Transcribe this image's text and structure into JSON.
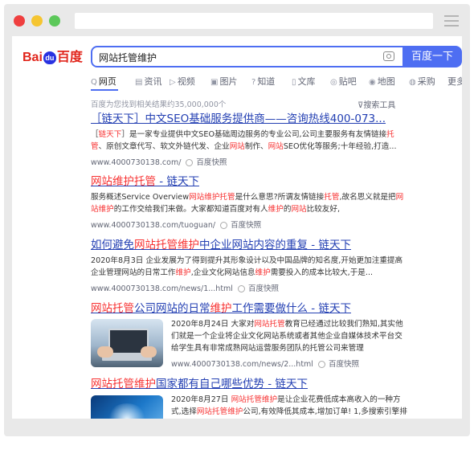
{
  "browser": {
    "url": ""
  },
  "logo": {
    "part1": "Bai",
    "paw": "du",
    "part2": "百度"
  },
  "search": {
    "query": "网站托管维护",
    "button": "百度一下"
  },
  "tabs": [
    {
      "icon": "Q",
      "label": "网页"
    },
    {
      "icon": "▤",
      "label": "资讯"
    },
    {
      "icon": "▷",
      "label": "视频"
    },
    {
      "icon": "▣",
      "label": "图片"
    },
    {
      "icon": "?",
      "label": "知道"
    },
    {
      "icon": "▯",
      "label": "文库"
    },
    {
      "icon": "◎",
      "label": "贴吧"
    },
    {
      "icon": "◉",
      "label": "地图"
    },
    {
      "icon": "◍",
      "label": "采购"
    },
    {
      "icon": "",
      "label": "更多"
    }
  ],
  "result_count": "百度为您找到相关结果约35,000,000个",
  "search_tools": "搜索工具",
  "results": [
    {
      "title": [
        [
          "",
          "［链天下］中文SEO基础服务提供商——咨询热线400-073..."
        ]
      ],
      "desc": [
        [
          "",
          "［"
        ],
        [
          "hl",
          "链天下"
        ],
        [
          "",
          "］是一家专业提供中文SEO基础周边服务的专业公司,公司主要服务有友情链接"
        ],
        [
          "hl",
          "托管"
        ],
        [
          "",
          "、原创文章代写、软文外链代发、企业"
        ],
        [
          "hl",
          "网站"
        ],
        [
          "",
          "制作、"
        ],
        [
          "hl",
          "网站"
        ],
        [
          "",
          "SEO优化等服务;十年经验,打造..."
        ]
      ],
      "url": "www.4000730138.com/",
      "snapshot": "百度快照"
    },
    {
      "title": [
        [
          "hl",
          "网站维护托管"
        ],
        [
          "",
          " - 链天下"
        ]
      ],
      "desc": [
        [
          "",
          "服务概述Service Overview"
        ],
        [
          "hl",
          "网站维护托管"
        ],
        [
          "",
          "是什么意思?所谓友情链接"
        ],
        [
          "hl",
          "托管"
        ],
        [
          "",
          ",故名思义就是把"
        ],
        [
          "hl",
          "网站维护"
        ],
        [
          "",
          "的工作交给我们来做。大家都知道百度对有人"
        ],
        [
          "hl",
          "维护"
        ],
        [
          "",
          "的"
        ],
        [
          "hl",
          "网站"
        ],
        [
          "",
          "比较友好,"
        ]
      ],
      "url": "www.4000730138.com/tuoguan/",
      "snapshot": "百度快照"
    },
    {
      "title": [
        [
          "",
          "如何避免"
        ],
        [
          "hl",
          "网站托管维护"
        ],
        [
          "",
          "中企业网站内容的重复 - 链天下"
        ]
      ],
      "desc": [
        [
          "",
          "2020年8月3日 企业发展为了得到提升其形象设计以及中国品牌的知名度,开始更加注重提高企业管理网站的日常工作"
        ],
        [
          "hl",
          "维护"
        ],
        [
          "",
          ",企业文化网站信息"
        ],
        [
          "hl",
          "维护"
        ],
        [
          "",
          "需要投入的成本比较大,于是..."
        ]
      ],
      "url": "www.4000730138.com/news/1...html",
      "snapshot": "百度快照"
    },
    {
      "title": [
        [
          "hl",
          "网站托管"
        ],
        [
          "",
          "公司网站的日常"
        ],
        [
          "hl",
          "维护"
        ],
        [
          "",
          "工作需要做什么 - 链天下"
        ]
      ],
      "desc": [
        [
          "",
          "2020年8月24日 大家对"
        ],
        [
          "hl",
          "网站托管"
        ],
        [
          "",
          "教育已经通过比较我们熟知,其实他们就是一个企业将企业文化网站系统或者其他企业自媒体技术平台交给学生具有非常成熟网站运营服务团队的托管公司来管理"
        ]
      ],
      "url": "www.4000730138.com/news/2...html",
      "snapshot": "百度快照"
    },
    {
      "title": [
        [
          "hl",
          "网站托管维护"
        ],
        [
          "",
          "国家都有自己哪些优势 - 链天下"
        ]
      ],
      "desc": [
        [
          "",
          "2020年8月27日 "
        ],
        [
          "hl",
          "网站托管维护"
        ],
        [
          "",
          "是让企业花费低成本高收入的一种方式,选择"
        ],
        [
          "hl",
          "网站托管维护"
        ],
        [
          "",
          "公司,有效降低其成本,增加订单! 1,多搜索引擎排名 网站做出来后还得优化,搜索引擎 数量 形象..."
        ]
      ],
      "url": "",
      "snapshot": ""
    }
  ]
}
